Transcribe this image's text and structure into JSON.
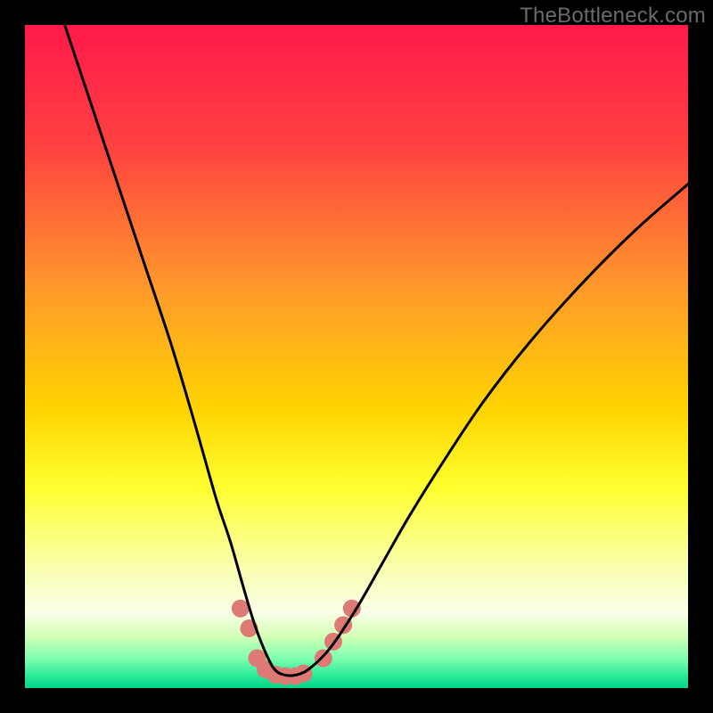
{
  "watermark": "TheBottleneck.com",
  "chart_data": {
    "type": "line",
    "title": "",
    "xlabel": "",
    "ylabel": "",
    "xlim": [
      0,
      100
    ],
    "ylim": [
      0,
      100
    ],
    "grid": false,
    "legend": false,
    "background_gradient_stops": [
      {
        "offset": 0.0,
        "color": "#ff1a4b"
      },
      {
        "offset": 0.18,
        "color": "#ff4040"
      },
      {
        "offset": 0.4,
        "color": "#ff9a2a"
      },
      {
        "offset": 0.58,
        "color": "#ffd400"
      },
      {
        "offset": 0.7,
        "color": "#ffff30"
      },
      {
        "offset": 0.82,
        "color": "#f9ffb0"
      },
      {
        "offset": 0.885,
        "color": "#faffe8"
      },
      {
        "offset": 0.92,
        "color": "#d6ffb8"
      },
      {
        "offset": 0.955,
        "color": "#7fffb0"
      },
      {
        "offset": 0.985,
        "color": "#20e895"
      },
      {
        "offset": 1.0,
        "color": "#00d488"
      }
    ],
    "series": [
      {
        "name": "bottleneck-curve",
        "color": "#000000",
        "stroke_width": 3,
        "x": [
          6,
          10,
          14,
          18,
          22,
          25,
          27,
          29,
          31,
          33,
          34.5,
          36,
          37.5,
          39,
          41,
          43,
          46,
          50,
          54,
          58,
          63,
          69,
          76,
          84,
          92,
          100
        ],
        "y": [
          100,
          88,
          76,
          64,
          52,
          42,
          35,
          28,
          22,
          15,
          10,
          6,
          3,
          2,
          2,
          3,
          6,
          12,
          19,
          26,
          34,
          43,
          52,
          61,
          69,
          76
        ]
      }
    ],
    "markers": {
      "name": "highlight-dots",
      "color": "#dd7a75",
      "radius": 10,
      "points": [
        {
          "x": 32.5,
          "y": 12
        },
        {
          "x": 33.8,
          "y": 9
        },
        {
          "x": 35.0,
          "y": 4.5
        },
        {
          "x": 36.3,
          "y": 2.8
        },
        {
          "x": 37.8,
          "y": 2.0
        },
        {
          "x": 39.3,
          "y": 1.8
        },
        {
          "x": 40.8,
          "y": 1.8
        },
        {
          "x": 42.0,
          "y": 2.2
        },
        {
          "x": 45.0,
          "y": 4.5
        },
        {
          "x": 46.5,
          "y": 7.0
        },
        {
          "x": 48.0,
          "y": 9.5
        },
        {
          "x": 49.3,
          "y": 12.0
        }
      ]
    }
  }
}
